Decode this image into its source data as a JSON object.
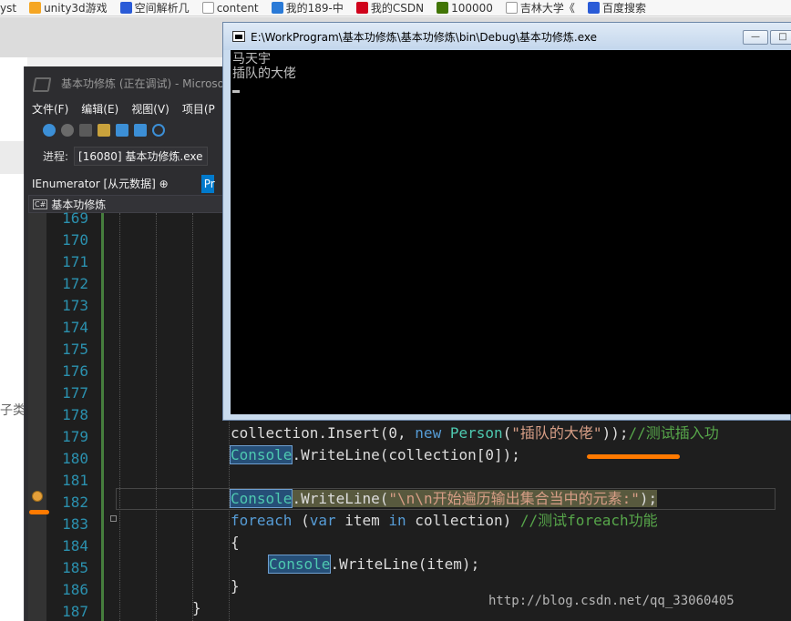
{
  "browser": {
    "bookmarks": [
      {
        "label": "yst",
        "color": "#8c8c8c"
      },
      {
        "label": "unity3d游戏",
        "color": "#f5a623"
      },
      {
        "label": "空间解析几",
        "color": "#2a5bd7"
      },
      {
        "label": "content",
        "color": "#bdbdbd"
      },
      {
        "label": "我的189-中",
        "color": "#2a7ad7"
      },
      {
        "label": "我的CSDN",
        "color": "#d0021b"
      },
      {
        "label": "100000",
        "color": "#417505"
      },
      {
        "label": "吉林大学《",
        "color": "#bdbdbd"
      },
      {
        "label": "百度搜索",
        "color": "#2a5bd7"
      }
    ],
    "page_fragment": "子类"
  },
  "vs": {
    "title": "基本功修炼 (正在调试) - Microso",
    "menu": [
      "文件(F)",
      "编辑(E)",
      "视图(V)",
      "项目(P"
    ],
    "process_label": "进程:",
    "process_value": "[16080] 基本功修炼.exe",
    "tab_label": "IEnumerator [从元数据] ⊕",
    "tab_pr": "Pr",
    "nav_project": "基本功修炼",
    "cs_icon": "C#"
  },
  "editor": {
    "line_numbers": [
      "169",
      "170",
      "171",
      "172",
      "173",
      "174",
      "175",
      "176",
      "177",
      "178",
      "179",
      "180",
      "181",
      "182",
      "183",
      "184",
      "185",
      "186",
      "187"
    ],
    "code": {
      "l179_a": "collection.Insert(0, ",
      "l179_new": "new",
      "l179_sp": " ",
      "l179_person": "Person",
      "l179_p1": "(",
      "l179_str": "\"插队的大佬\"",
      "l179_p2": "));",
      "l179_cm": "//测试插入功",
      "l180_console": "Console",
      "l180_rest": ".WriteLine(collection[0]);",
      "l182_console": "Console",
      "l182_mid": ".WriteLine(",
      "l182_str": "\"\\n\\n开始遍历输出集合当中的元素:\"",
      "l182_end": ");",
      "l183_foreach": "foreach",
      "l183_p1": " (",
      "l183_var": "var",
      "l183_item": " item ",
      "l183_in": "in",
      "l183_coll": " collection) ",
      "l183_cm": "//测试foreach功能",
      "l184": "{",
      "l185_console": "Console",
      "l185_rest": ".WriteLine(item);",
      "l186": "}",
      "l187": "}"
    }
  },
  "console_window": {
    "title": "E:\\WorkProgram\\基本功修炼\\基本功修炼\\bin\\Debug\\基本功修炼.exe",
    "output": [
      "马天宇",
      "插队的大佬"
    ],
    "btn_min": "—",
    "btn_max": "□"
  },
  "watermark": "http://blog.csdn.net/qq_33060405",
  "colors": {
    "accent": "#007acc",
    "annotation": "#ff7a00"
  }
}
